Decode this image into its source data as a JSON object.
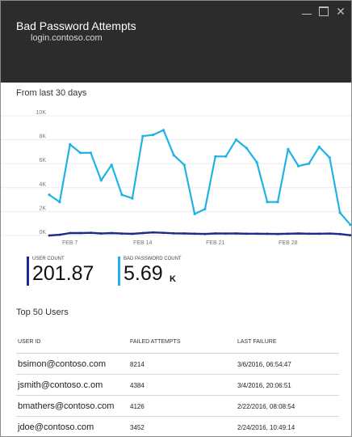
{
  "window": {
    "title": "Bad Password Attempts",
    "subtitle": "login.contoso.com",
    "close_glyph": "✕"
  },
  "range_label": "From last 30 days",
  "chart_data": {
    "type": "line",
    "y_ticks": [
      "10K",
      "8K",
      "6K",
      "4K",
      "2K",
      "0K"
    ],
    "ylim": [
      0,
      10000
    ],
    "x_labels": [
      {
        "index": 2,
        "label": "FEB 7"
      },
      {
        "index": 9,
        "label": "FEB 14"
      },
      {
        "index": 16,
        "label": "FEB 21"
      },
      {
        "index": 23,
        "label": "FEB 28"
      }
    ],
    "grid": true,
    "series": [
      {
        "name": "BAD PASSWORD COUNT",
        "color": "#1fb3e5",
        "values": [
          3400,
          2800,
          7600,
          6900,
          6900,
          4600,
          5900,
          3400,
          3100,
          8300,
          8400,
          8800,
          6700,
          5900,
          1800,
          2200,
          6600,
          6600,
          8000,
          7300,
          6100,
          2800,
          2800,
          7200,
          5800,
          6000,
          7400,
          6500,
          1900,
          900
        ]
      },
      {
        "name": "USER COUNT",
        "color": "#1c2a8a",
        "values": [
          0,
          60,
          200,
          200,
          220,
          170,
          200,
          160,
          140,
          200,
          260,
          220,
          180,
          170,
          150,
          130,
          170,
          160,
          170,
          150,
          150,
          140,
          130,
          150,
          170,
          150,
          150,
          160,
          120,
          20
        ]
      }
    ]
  },
  "tiles": [
    {
      "label": "USER COUNT",
      "value": "201.87",
      "unit": "",
      "color": "#1c2a8a"
    },
    {
      "label": "BAD PASSWORD COUNT",
      "value": "5.69",
      "unit": "K",
      "color": "#1fb3e5"
    }
  ],
  "top_users_label": "Top 50 Users",
  "table": {
    "headers": [
      "USER ID",
      "FAILED ATTEMPTS",
      "LAST FAILURE"
    ],
    "rows": [
      [
        "bsimon@contoso.com",
        "8214",
        "3/6/2016, 06:54:47"
      ],
      [
        "jsmith@contoso.c.om",
        "4384",
        "3/4/2016, 20:06:51"
      ],
      [
        "bmathers@contoso.com",
        "4126",
        "2/22/2016, 08:08:54"
      ],
      [
        "jdoe@contoso.com",
        "3452",
        "2/24/2016, 10:49:14"
      ]
    ]
  }
}
